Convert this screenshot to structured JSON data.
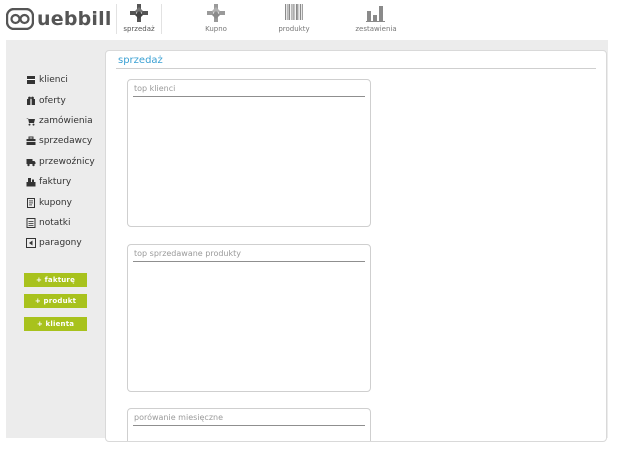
{
  "app": {
    "logo_text": "uebbill"
  },
  "nav": {
    "items": [
      {
        "label": "sprzedaż",
        "icon": "sales-icon"
      },
      {
        "label": "Kupno",
        "icon": "purchase-icon"
      },
      {
        "label": "produkty",
        "icon": "barcode-icon"
      },
      {
        "label": "zestawienia",
        "icon": "bar-chart-icon"
      }
    ]
  },
  "sidebar": {
    "items": [
      {
        "label": "klienci",
        "icon": "clients-icon"
      },
      {
        "label": "oferty",
        "icon": "offers-icon"
      },
      {
        "label": "zamówienia",
        "icon": "orders-icon"
      },
      {
        "label": "sprzedawcy",
        "icon": "sellers-icon"
      },
      {
        "label": "przewoźnicy",
        "icon": "carriers-icon"
      },
      {
        "label": "faktury",
        "icon": "invoices-icon"
      },
      {
        "label": "kupony",
        "icon": "coupons-icon"
      },
      {
        "label": "notatki",
        "icon": "notes-icon"
      },
      {
        "label": "paragony",
        "icon": "receipts-icon"
      }
    ],
    "buttons": [
      {
        "label": "+ fakturę"
      },
      {
        "label": "+ produkt"
      },
      {
        "label": "+ klienta"
      }
    ]
  },
  "main": {
    "title": "sprzedaż",
    "cards": [
      {
        "title": "top klienci"
      },
      {
        "title": "top sprzedawane produkty"
      },
      {
        "title": "porówanie miesięczne"
      }
    ]
  },
  "colors": {
    "accent_green": "#a8c21d",
    "title_blue": "#3aa0d3",
    "background_grey": "#ececec"
  }
}
